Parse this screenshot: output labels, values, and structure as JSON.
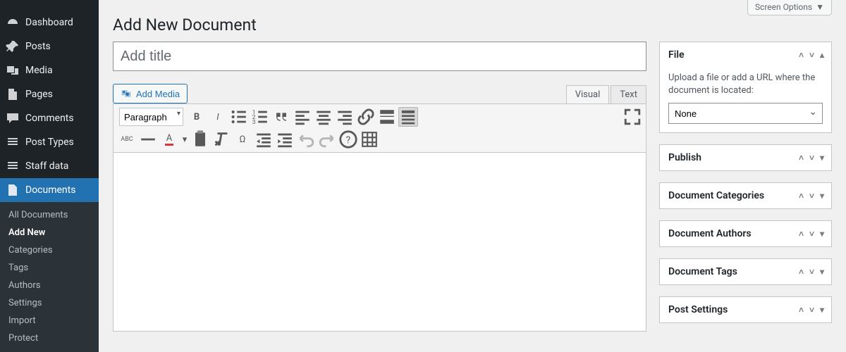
{
  "screen_options": "Screen Options",
  "page_title": "Add New Document",
  "title_placeholder": "Add title",
  "sidebar": {
    "items": [
      {
        "label": "Dashboard",
        "icon": "dashboard"
      },
      {
        "label": "Posts",
        "icon": "pin"
      },
      {
        "label": "Media",
        "icon": "media"
      },
      {
        "label": "Pages",
        "icon": "page"
      },
      {
        "label": "Comments",
        "icon": "comment"
      },
      {
        "label": "Post Types",
        "icon": "post-types"
      },
      {
        "label": "Staff data",
        "icon": "staff"
      },
      {
        "label": "Documents",
        "icon": "documents",
        "active": true
      }
    ],
    "submenu": [
      "All Documents",
      "Add New",
      "Categories",
      "Tags",
      "Authors",
      "Settings",
      "Import",
      "Protect"
    ],
    "submenu_current": "Add New"
  },
  "editor": {
    "add_media": "Add Media",
    "tabs": {
      "visual": "Visual",
      "text": "Text"
    },
    "format_select": "Paragraph"
  },
  "file_box": {
    "title": "File",
    "hint": "Upload a file or add a URL where the document is located:",
    "select_value": "None"
  },
  "side_boxes": [
    {
      "title": "Publish"
    },
    {
      "title": "Document Categories"
    },
    {
      "title": "Document Authors"
    },
    {
      "title": "Document Tags"
    },
    {
      "title": "Post Settings"
    }
  ]
}
